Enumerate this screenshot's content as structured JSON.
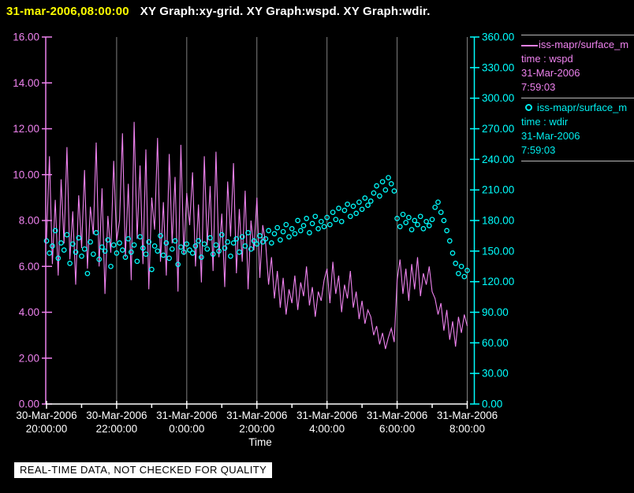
{
  "header": {
    "datetime": "31-mar-2006,08:00:00",
    "graphs_label": "XY Graph:xy-grid.  XY Graph:wspd.  XY Graph:wdir."
  },
  "notice": {
    "text": "REAL-TIME DATA, NOT CHECKED FOR QUALITY"
  },
  "colors": {
    "background": "#000000",
    "wspd_line": "#ee82ee",
    "wdir_marker": "#00ffff",
    "left_axis": "#ee82ee",
    "right_axis": "#00ffff",
    "x_axis": "#ffffff",
    "grid": "#808080",
    "title_datetime": "#ffff00",
    "title_text": "#ffffff",
    "legend_rule": "#b8b8b8"
  },
  "chart_data": {
    "type": "line",
    "title": "",
    "x_axis": {
      "label": "Time",
      "start": "30-Mar-2006 20:00:00",
      "end": "31-Mar-2006 8:00:00",
      "span_hours": 12,
      "grid_hours": [
        2,
        4,
        6,
        8,
        10,
        12
      ],
      "minor_tick_hours": [
        1,
        3,
        5,
        7,
        9,
        11
      ],
      "ticks": [
        {
          "hour": 0,
          "date": "30-Mar-2006",
          "time": "20:00:00"
        },
        {
          "hour": 2,
          "date": "30-Mar-2006",
          "time": "22:00:00"
        },
        {
          "hour": 4,
          "date": "31-Mar-2006",
          "time": "0:00:00"
        },
        {
          "hour": 6,
          "date": "31-Mar-2006",
          "time": "2:00:00"
        },
        {
          "hour": 8,
          "date": "31-Mar-2006",
          "time": "4:00:00"
        },
        {
          "hour": 10,
          "date": "31-Mar-2006",
          "time": "6:00:00"
        },
        {
          "hour": 12,
          "date": "31-Mar-2006",
          "time": "8:00:00"
        }
      ]
    },
    "y_left": {
      "min": 0,
      "max": 16,
      "color": "#ee82ee",
      "series": "wspd",
      "tick_values": [
        0,
        2,
        4,
        6,
        8,
        10,
        12,
        14,
        16
      ],
      "tick_labels": [
        "0.00",
        "2.00",
        "4.00",
        "6.00",
        "8.00",
        "10.00",
        "12.00",
        "14.00",
        "16.00"
      ]
    },
    "y_right": {
      "min": 0,
      "max": 360,
      "color": "#00ffff",
      "series": "wdir",
      "tick_values": [
        0,
        30,
        60,
        90,
        120,
        150,
        180,
        210,
        240,
        270,
        300,
        330,
        360
      ],
      "tick_labels": [
        "0.00",
        "30.00",
        "60.00",
        "90.00",
        "120.00",
        "150.00",
        "180.00",
        "210.00",
        "240.00",
        "270.00",
        "300.00",
        "330.00",
        "360.00"
      ]
    },
    "sample_interval_minutes": 5,
    "series": [
      {
        "name": "iss-mapr/surface_m",
        "var_label": "time : wspd",
        "date": "31-Mar-2006",
        "time": "7:59:03",
        "type": "line",
        "axis": "left",
        "color": "#ee82ee",
        "values": [
          7.2,
          10.8,
          6.1,
          8.9,
          5.6,
          9.8,
          7.0,
          11.2,
          6.3,
          8.4,
          5.2,
          9.1,
          6.8,
          10.2,
          5.9,
          8.6,
          7.4,
          11.4,
          6.0,
          9.4,
          4.8,
          8.2,
          6.6,
          10.6,
          7.1,
          8.0,
          11.8,
          6.4,
          9.6,
          5.4,
          12.3,
          7.2,
          10.4,
          6.1,
          11.1,
          5.0,
          9.0,
          7.6,
          11.6,
          6.2,
          8.8,
          5.6,
          10.9,
          7.0,
          9.9,
          4.9,
          11.3,
          6.5,
          9.2,
          7.8,
          10.1,
          6.0,
          8.7,
          5.3,
          10.8,
          6.9,
          9.5,
          5.8,
          11.0,
          6.4,
          8.3,
          5.1,
          9.7,
          7.3,
          10.5,
          5.7,
          8.5,
          6.2,
          9.3,
          5.0,
          8.0,
          6.7,
          9.0,
          5.5,
          7.8,
          7.0,
          5.2,
          6.4,
          4.6,
          5.8,
          4.2,
          5.5,
          3.9,
          5.0,
          4.4,
          5.6,
          4.1,
          5.3,
          4.7,
          6.0,
          4.3,
          5.1,
          3.8,
          4.9,
          4.5,
          5.4,
          5.9,
          4.4,
          6.2,
          4.8,
          5.6,
          4.0,
          5.2,
          4.6,
          5.8,
          4.2,
          4.9,
          3.7,
          4.5,
          3.5,
          4.1,
          3.8,
          3.0,
          3.4,
          2.6,
          3.1,
          2.4,
          2.9,
          3.3,
          2.7,
          5.4,
          6.3,
          4.8,
          5.9,
          4.5,
          6.1,
          5.0,
          6.4,
          4.7,
          5.7,
          5.2,
          6.0,
          4.9,
          4.6,
          3.9,
          4.4,
          3.2,
          4.1,
          2.8,
          3.6,
          2.5,
          3.8,
          3.1,
          3.9,
          3.4
        ]
      },
      {
        "name": "iss-mapr/surface_m",
        "var_label": "time : wdir",
        "date": "31-Mar-2006",
        "time": "7:59:03",
        "type": "scatter",
        "axis": "right",
        "color": "#00ffff",
        "values": [
          160,
          148,
          155,
          170,
          143,
          158,
          151,
          166,
          138,
          157,
          149,
          163,
          145,
          152,
          128,
          159,
          147,
          168,
          142,
          154,
          150,
          161,
          135,
          156,
          148,
          158,
          151,
          144,
          162,
          149,
          156,
          140,
          164,
          153,
          147,
          159,
          132,
          155,
          150,
          165,
          146,
          158,
          143,
          152,
          160,
          137,
          154,
          149,
          157,
          151,
          148,
          155,
          160,
          144,
          157,
          152,
          163,
          147,
          156,
          150,
          166,
          153,
          159,
          145,
          158,
          162,
          149,
          164,
          155,
          168,
          152,
          160,
          157,
          165,
          159,
          162,
          170,
          158,
          167,
          173,
          161,
          169,
          176,
          164,
          172,
          167,
          180,
          170,
          175,
          182,
          168,
          177,
          184,
          172,
          179,
          174,
          183,
          176,
          188,
          181,
          192,
          179,
          190,
          196,
          184,
          194,
          187,
          198,
          191,
          202,
          195,
          199,
          207,
          214,
          204,
          218,
          210,
          222,
          216,
          209,
          182,
          174,
          186,
          178,
          183,
          171,
          180,
          176,
          184,
          172,
          179,
          175,
          181,
          193,
          198,
          188,
          180,
          170,
          160,
          148,
          138,
          128,
          135,
          125,
          131
        ]
      }
    ]
  }
}
